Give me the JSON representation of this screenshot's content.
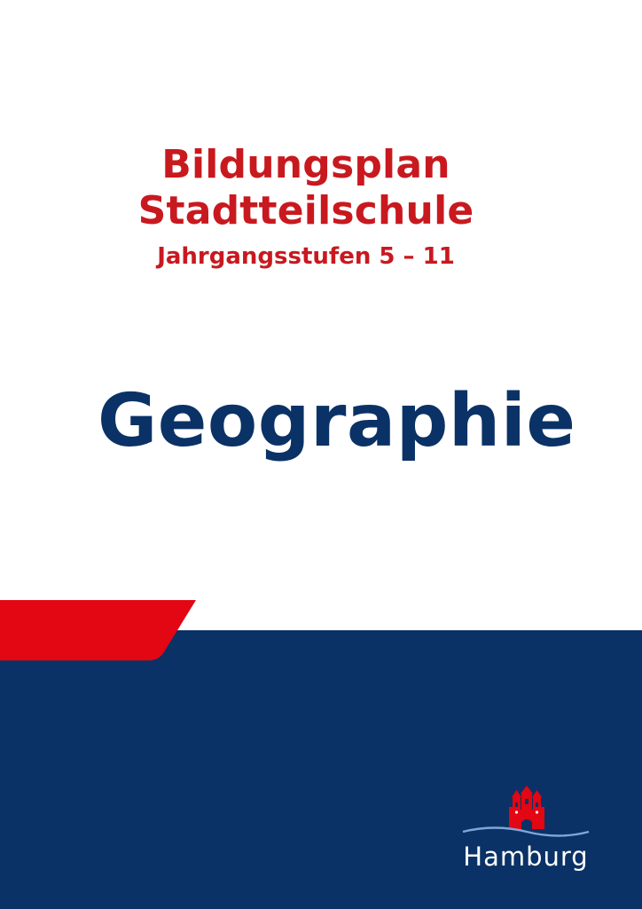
{
  "cover": {
    "title_line1": "Bildungsplan",
    "title_line2": "Stadtteilschule",
    "subtitle": "Jahrgangsstufen 5 – 11",
    "subject": "Geographie"
  },
  "logo": {
    "text": "Hamburg",
    "icon": "hamburg-castle-icon"
  },
  "colors": {
    "red": "#c8191f",
    "navy": "#0a3266",
    "band_red": "#e30613",
    "white": "#ffffff",
    "wave": "#7fa6d6"
  }
}
